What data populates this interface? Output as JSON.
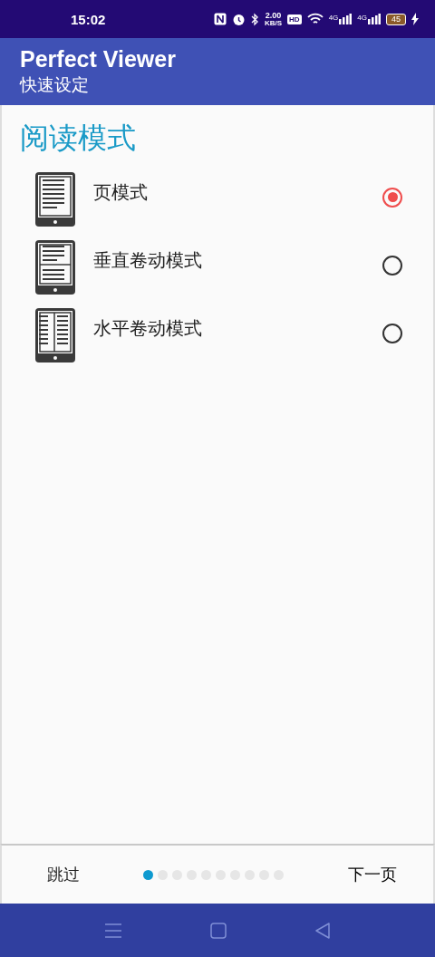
{
  "status_bar": {
    "time": "15:02",
    "speed": "2.00",
    "speed_unit": "KB/S",
    "hd": "HD",
    "network_1": "4G",
    "network_2": "4G",
    "battery": "45"
  },
  "app_bar": {
    "title": "Perfect Viewer",
    "subtitle": "快速设定"
  },
  "section_title": "阅读模式",
  "modes": [
    {
      "kind": "page",
      "label": "页模式",
      "selected": true
    },
    {
      "kind": "vertical",
      "label": "垂直卷动模式",
      "selected": false
    },
    {
      "kind": "horizontal",
      "label": "水平卷动模式",
      "selected": false
    }
  ],
  "footer": {
    "skip": "跳过",
    "next": "下一页",
    "pages": [
      {
        "selected": true
      },
      {
        "selected": false
      },
      {
        "selected": false
      },
      {
        "selected": false
      },
      {
        "selected": false
      },
      {
        "selected": false
      },
      {
        "selected": false
      },
      {
        "selected": false
      },
      {
        "selected": false
      },
      {
        "selected": false
      }
    ]
  }
}
